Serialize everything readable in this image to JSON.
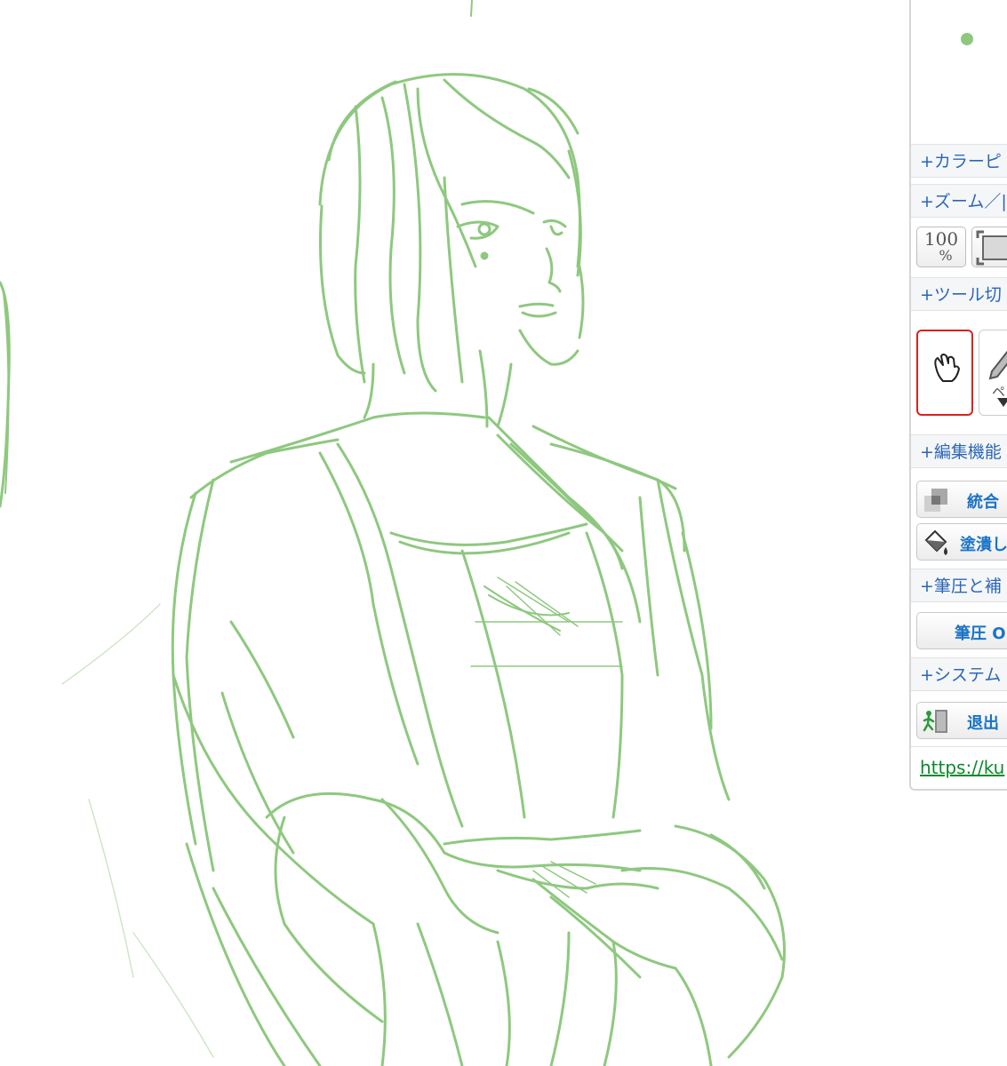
{
  "canvas": {
    "stroke_color": "#8ec87f"
  },
  "panel": {
    "current_color": "#8ec87f",
    "sections": {
      "color_picker": "+カラーピ",
      "zoom": "+ズーム／|",
      "tool_switch": "+ツール切",
      "edit": "+編集機能",
      "pressure": "+筆圧と補",
      "system": "+システム"
    },
    "zoom_buttons": {
      "actual_size_top": "100",
      "actual_size_bottom": "%"
    },
    "tools": {
      "pen_label": "ペ"
    },
    "edit_buttons": {
      "merge": "統合",
      "fill": "塗潰し"
    },
    "pressure_button": "筆圧 ON",
    "system_buttons": {
      "exit": "退出"
    },
    "link_text": "https://ku"
  },
  "colors": {
    "section_text": "#2b67b5",
    "button_text": "#1a73c6",
    "link": "#0b8a2c",
    "selected_tool_border": "#d9211e"
  }
}
